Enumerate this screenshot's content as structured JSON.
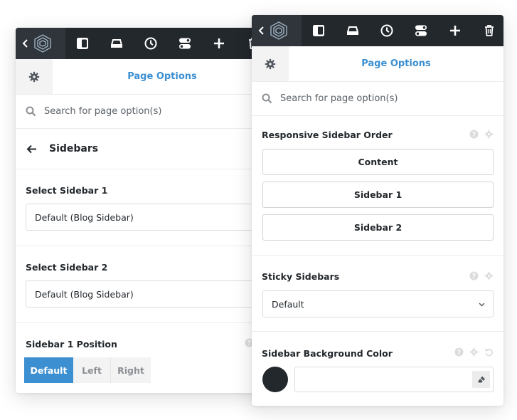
{
  "colors": {
    "toolbar_bg": "#23282d",
    "logo_bg": "#2f353b",
    "accent": "#3c8fd1",
    "text": "#23282d",
    "border": "#dcdcdc",
    "swatch": "#23282d"
  },
  "toolbar": {
    "collapse_icon": "chevron-left-icon",
    "logo_icon": "avada-logo-icon",
    "buttons": [
      {
        "icon": "sidebar-layout-icon"
      },
      {
        "icon": "header-layout-icon"
      },
      {
        "icon": "history-clock-icon"
      },
      {
        "icon": "toggle-options-icon"
      },
      {
        "icon": "plus-icon"
      },
      {
        "icon": "trash-icon"
      }
    ]
  },
  "back_panel": {
    "header_title": "Page Options",
    "search_placeholder": "Search for page option(s)",
    "breadcrumb": "Sidebars",
    "sections": {
      "sidebar1": {
        "label": "Select Sidebar 1",
        "value": "Default (Blog Sidebar)"
      },
      "sidebar2": {
        "label": "Select Sidebar 2",
        "value": "Default (Blog Sidebar)"
      },
      "position": {
        "label": "Sidebar 1 Position",
        "options": [
          "Default",
          "Left",
          "Right"
        ],
        "selected": "Default"
      }
    }
  },
  "front_panel": {
    "header_title": "Page Options",
    "search_placeholder": "Search for page option(s)",
    "sections": {
      "order": {
        "label": "Responsive Sidebar Order",
        "items": [
          "Content",
          "Sidebar 1",
          "Sidebar 2"
        ]
      },
      "sticky": {
        "label": "Sticky Sidebars",
        "value": "Default"
      },
      "bg_color": {
        "label": "Sidebar Background Color",
        "value": ""
      }
    }
  }
}
